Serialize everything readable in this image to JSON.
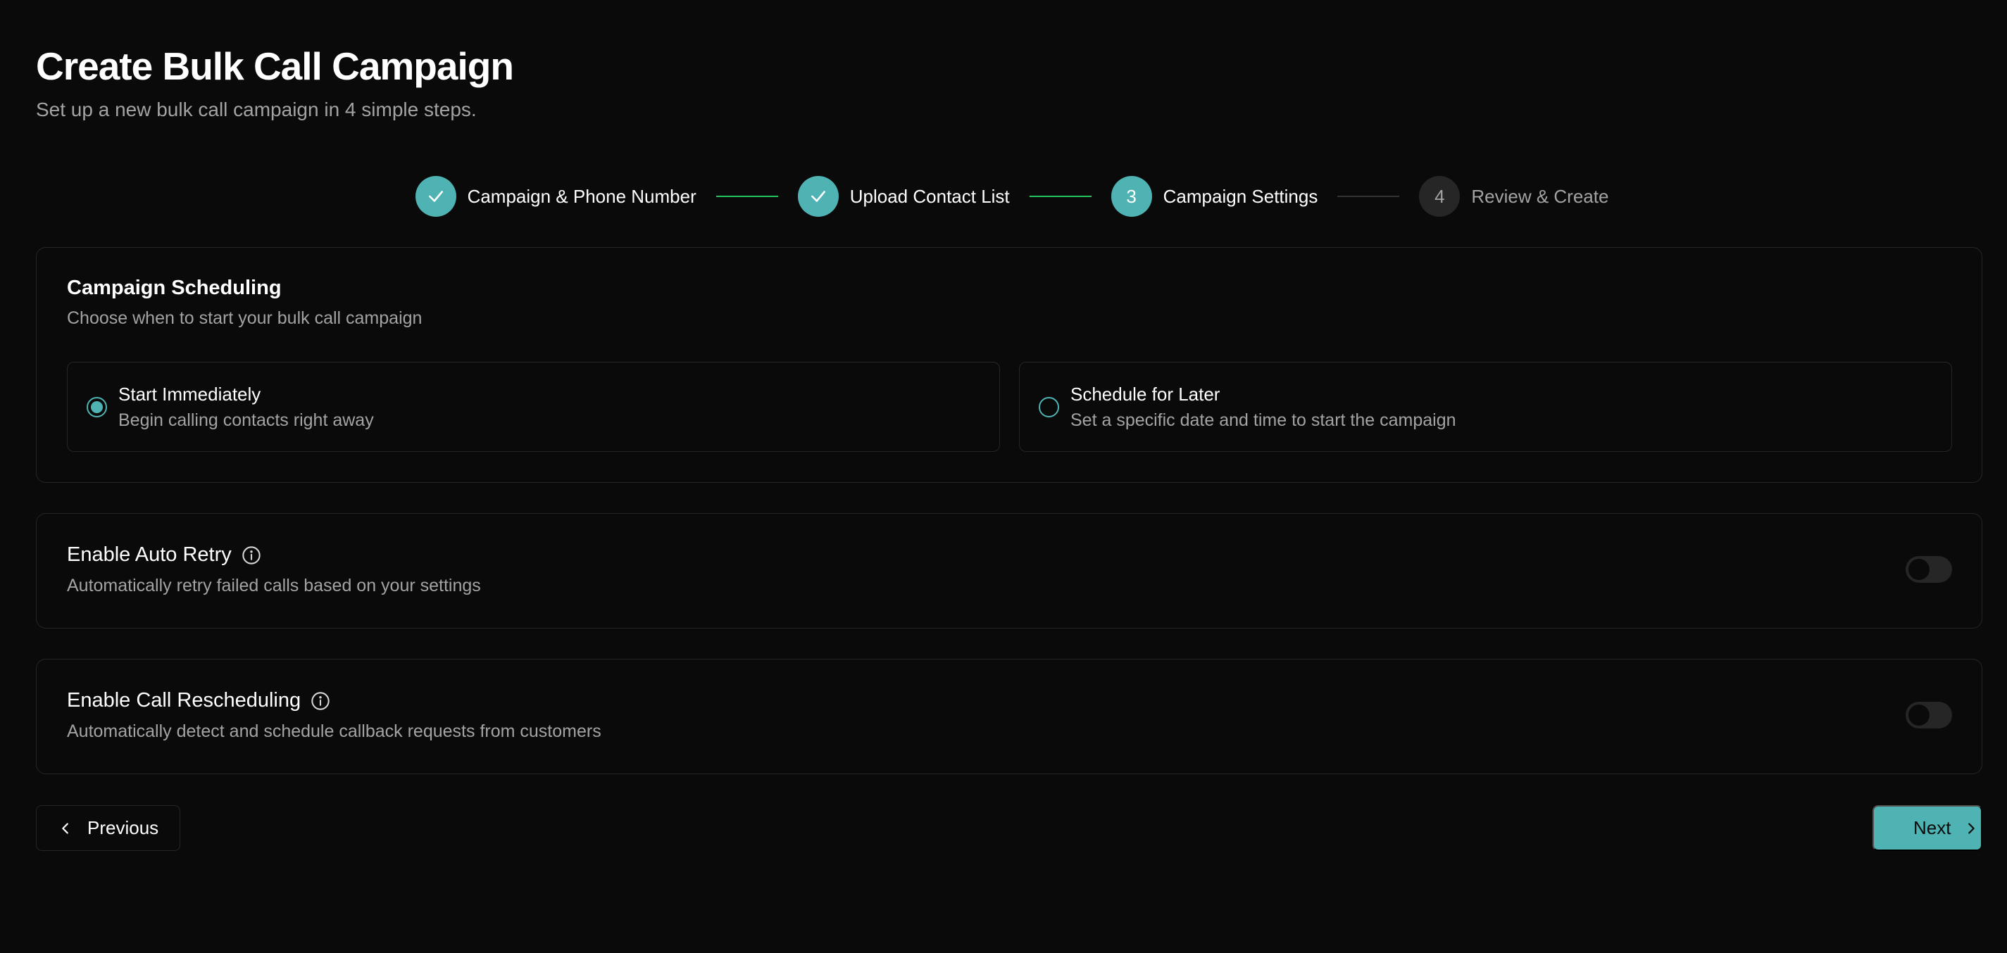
{
  "header": {
    "title": "Create Bulk Call Campaign",
    "subtitle": "Set up a new bulk call campaign in 4 simple steps."
  },
  "stepper": {
    "steps": [
      {
        "number": "1",
        "label": "Campaign & Phone Number",
        "status": "completed"
      },
      {
        "number": "2",
        "label": "Upload Contact List",
        "status": "completed"
      },
      {
        "number": "3",
        "label": "Campaign Settings",
        "status": "active"
      },
      {
        "number": "4",
        "label": "Review & Create",
        "status": "pending"
      }
    ]
  },
  "scheduling": {
    "title": "Campaign Scheduling",
    "description": "Choose when to start your bulk call campaign",
    "options": [
      {
        "title": "Start Immediately",
        "description": "Begin calling contacts right away",
        "selected": true
      },
      {
        "title": "Schedule for Later",
        "description": "Set a specific date and time to start the campaign",
        "selected": false
      }
    ]
  },
  "auto_retry": {
    "title": "Enable Auto Retry",
    "description": "Automatically retry failed calls based on your settings",
    "enabled": false
  },
  "call_rescheduling": {
    "title": "Enable Call Rescheduling",
    "description": "Automatically detect and schedule callback requests from customers",
    "enabled": false
  },
  "navigation": {
    "previous_label": "Previous",
    "next_label": "Next"
  },
  "colors": {
    "accent": "#4fb3b3",
    "connector_done": "#22c55e",
    "background": "#0a0a0a",
    "border": "#262626",
    "muted_text": "#a3a3a3"
  }
}
